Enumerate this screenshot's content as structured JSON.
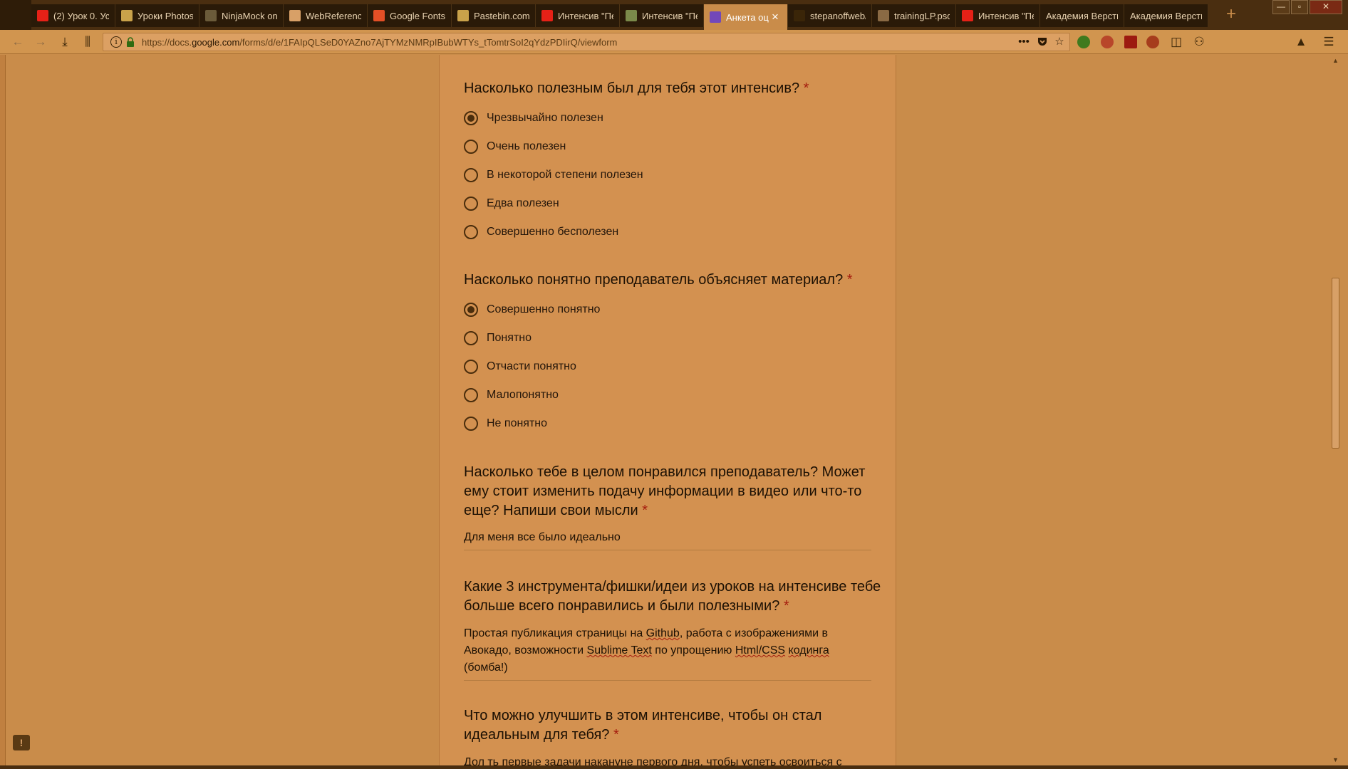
{
  "browser": {
    "tabs": [
      {
        "title": "(2) Урок 0. Ус",
        "favicon": "youtube-icon",
        "color": "#e62117"
      },
      {
        "title": "Уроки Photosh",
        "favicon": "photoshop-lessons-icon",
        "color": "#c9a24a"
      },
      {
        "title": "NinjaMock onl",
        "favicon": "ninjamock-icon",
        "color": "#6b5b3a"
      },
      {
        "title": "WebReference",
        "favicon": "webreference-icon",
        "color": "#d8a067"
      },
      {
        "title": "Google Fonts",
        "favicon": "google-fonts-icon",
        "color": "#e34f26"
      },
      {
        "title": "Pastebin.com",
        "favicon": "pastebin-icon",
        "color": "#c9a24a"
      },
      {
        "title": "Интенсив \"Пе",
        "favicon": "youtube-icon",
        "color": "#e62117"
      },
      {
        "title": "Интенсив \"Пе",
        "favicon": "academy-icon",
        "color": "#7b8a4a"
      },
      {
        "title": "Анкета оц",
        "favicon": "google-forms-icon",
        "color": "#7248b9",
        "active": true
      },
      {
        "title": "stepanoffweb/",
        "favicon": "github-icon",
        "color": "#3a2508"
      },
      {
        "title": "trainingLP.psd",
        "favicon": "avocode-icon",
        "color": "#8a6a44"
      },
      {
        "title": "Интенсив \"Пе",
        "favicon": "youtube-icon",
        "color": "#e62117"
      },
      {
        "title": "Академия Верстки",
        "favicon": "none",
        "color": "#2a1a08"
      },
      {
        "title": "Академия Верстки",
        "favicon": "none",
        "color": "#2a1a08"
      }
    ],
    "new_tab": "+",
    "window_controls": {
      "minimize": "—",
      "maximize": "▫",
      "close": "✕"
    },
    "url": {
      "prefix": "https://docs.",
      "domain": "google.com",
      "path": "/forms/d/e/1FAIpQLSeD0YAZno7AjTYMzNMRpIBubWTYs_tTomtrSoI2qYdzPDIirQ/viewform"
    }
  },
  "form": {
    "q1": {
      "title": "Насколько полезным был для тебя этот интенсив?",
      "required_mark": "*",
      "options": [
        "Чрезвычайно полезен",
        "Очень полезен",
        "В некоторой степени полезен",
        "Едва полезен",
        "Совершенно бесполезен"
      ],
      "selected_index": 0
    },
    "q2": {
      "title": "Насколько понятно преподаватель объясняет материал?",
      "required_mark": "*",
      "options": [
        "Совершенно понятно",
        "Понятно",
        "Отчасти понятно",
        "Малопонятно",
        "Не понятно"
      ],
      "selected_index": 0
    },
    "q3": {
      "title": "Насколько тебе в целом понравился преподаватель? Может ему стоит изменить подачу информации в видео или что-то еще? Напиши свои мысли",
      "required_mark": "*",
      "answer": "Для меня все было идеально"
    },
    "q4": {
      "title": "Какие 3 инструмента/фишки/идеи из уроков на интенсиве тебе больше всего понравились и были полезными?",
      "required_mark": "*",
      "answer": {
        "p1": "Простая публикация страницы на ",
        "w1": "Github",
        "p2": ", работа с изображениями в Авокадо, возможности ",
        "w2": "Sublime Text",
        "p3": " по упрощению ",
        "w3": "Html/CSS",
        "p4": " ",
        "w4": "кодинга",
        "p5": " (бомба!)"
      }
    },
    "q5": {
      "title": "Что можно улучшить в этом интенсиве, чтобы он стал идеальным для тебя?",
      "required_mark": "*",
      "answer_partial": "Дол ть первые задачи накануне первого дня, чтобы успеть освоиться с"
    }
  },
  "feedback_icon": "!",
  "colors": {
    "background": "#c98c4a",
    "card": "#d39150",
    "required": "#a51d0e",
    "tabstrip": "#4a2e10"
  }
}
